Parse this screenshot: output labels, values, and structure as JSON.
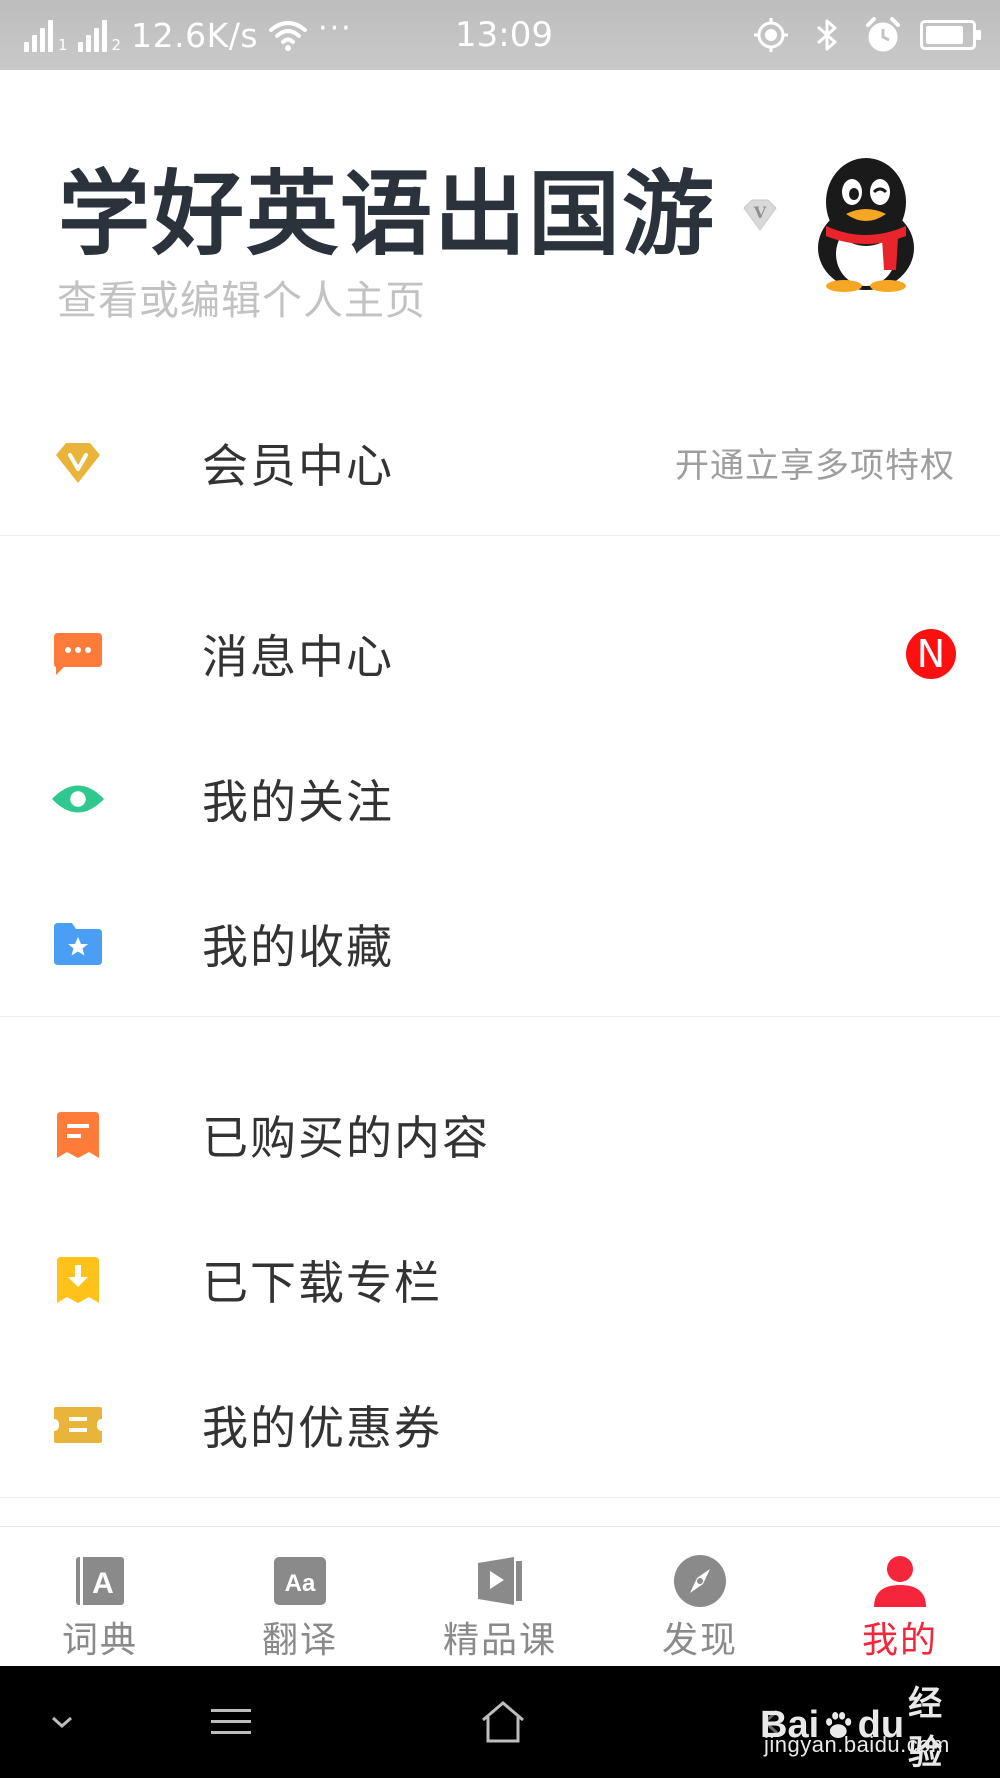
{
  "status_bar": {
    "sim1": "1",
    "sim2": "2",
    "net_speed": "12.6K/s",
    "more": "···",
    "time": "13:09",
    "battery_level": 0.85
  },
  "profile": {
    "name": "学好英语出国游",
    "subtitle": "查看或编辑个人主页",
    "vip_badge_letter": "V"
  },
  "menu": {
    "vip_center": {
      "label": "会员中心",
      "extra": "开通立享多项特权",
      "icon": "diamond-v-icon",
      "icon_color": "#e8b53a"
    },
    "message_center": {
      "label": "消息中心",
      "badge": "N",
      "icon": "chat-bubble-icon",
      "icon_color": "#ff7b3a",
      "badge_color": "#ff1010"
    },
    "my_follow": {
      "label": "我的关注",
      "icon": "eye-icon",
      "icon_color": "#2fc98f"
    },
    "my_favorites": {
      "label": "我的收藏",
      "icon": "star-folder-icon",
      "icon_color": "#4a9ff5"
    },
    "purchased": {
      "label": "已购买的内容",
      "icon": "receipt-icon",
      "icon_color": "#ff7b3a"
    },
    "downloaded": {
      "label": "已下载专栏",
      "icon": "download-icon",
      "icon_color": "#ffc21a"
    },
    "coupons": {
      "label": "我的优惠券",
      "icon": "ticket-icon",
      "icon_color": "#e8b53a"
    }
  },
  "tabs": [
    {
      "label": "词典",
      "icon": "dictionary-icon",
      "icon_text": "A",
      "active": false
    },
    {
      "label": "翻译",
      "icon": "translate-icon",
      "icon_text": "Aa",
      "active": false
    },
    {
      "label": "精品课",
      "icon": "course-icon",
      "active": false
    },
    {
      "label": "发现",
      "icon": "compass-icon",
      "active": false
    },
    {
      "label": "我的",
      "icon": "person-icon",
      "active": true
    }
  ],
  "colors": {
    "accent": "#f5263b",
    "tab_inactive": "#8a8a8a"
  },
  "watermark": {
    "brand_a": "Bai",
    "brand_b": "du",
    "brand_cn": "经验",
    "url": "jingyan.baidu.com"
  }
}
